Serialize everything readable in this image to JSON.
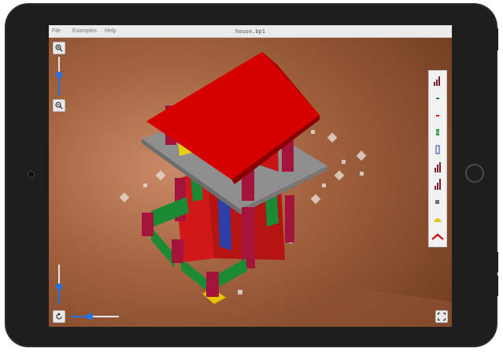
{
  "menu": {
    "file": "File",
    "examples": "Examples",
    "help": "Help"
  },
  "document": {
    "title": "house.bp1"
  },
  "controls": {
    "zoom_in_icon": "zoom-in-icon",
    "zoom_out_icon": "zoom-out-icon",
    "zoom_level": 0.55,
    "tilt_level": 0.45,
    "rotation_level": 0.4,
    "rotate_icon": "rotate-icon",
    "fullscreen_icon": "fullscreen-icon"
  },
  "palette": [
    {
      "name": "palette-stepped-column-icon",
      "color": "#7a1a2b"
    },
    {
      "name": "palette-green-bar-icon",
      "color": "#1d7a2e"
    },
    {
      "name": "palette-red-bar-icon",
      "color": "#d11a1a"
    },
    {
      "name": "palette-green-block-icon",
      "color": "#2a9c3c"
    },
    {
      "name": "palette-blue-frame-icon",
      "color": "#2b3fa6"
    },
    {
      "name": "palette-stepped-column-2-icon",
      "color": "#7a1a2b"
    },
    {
      "name": "palette-stepped-column-3-icon",
      "color": "#7a1a2b"
    },
    {
      "name": "palette-gray-tile-icon",
      "color": "#6e6e6e"
    },
    {
      "name": "palette-yellow-arch-icon",
      "color": "#e1c21b"
    },
    {
      "name": "palette-red-roof-icon",
      "color": "#c91515"
    }
  ],
  "colors": {
    "roof": "#d60000",
    "wall_yellow": "#e3d00f",
    "pillar": "#a3133a",
    "fence": "#1a8a34",
    "floor_gray": "#8f8f8f",
    "slider_accent": "#1f74e6"
  }
}
